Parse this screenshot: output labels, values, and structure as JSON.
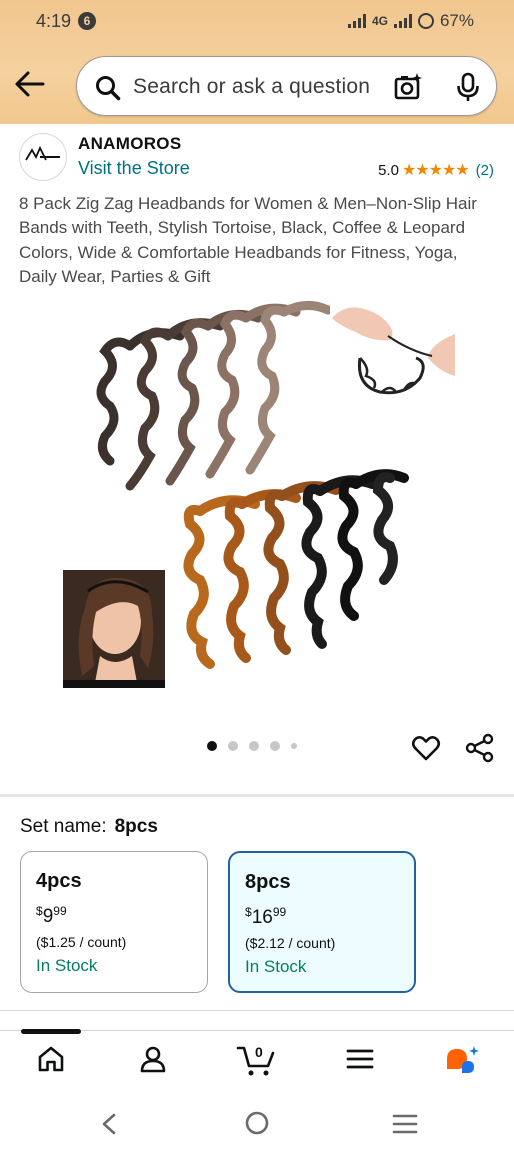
{
  "status_bar": {
    "time": "4:19",
    "notification_count": "6",
    "network": "4G",
    "battery": "67%"
  },
  "search": {
    "placeholder": "Search or ask a question"
  },
  "brand": {
    "name": "ANAMOROS",
    "visit_link": "Visit the Store",
    "rating": "5.0",
    "stars": "★★★★★",
    "review_count": "(2)"
  },
  "product": {
    "title": "8 Pack Zig Zag Headbands for Women & Men–Non-Slip Hair Bands with Teeth, Stylish Tortoise, Black, Coffee & Leopard Colors, Wide & Comfortable Headbands for Fitness, Yoga, Daily Wear, Parties & Gift",
    "image_count": 5,
    "current_image": 1
  },
  "set_name": {
    "label": "Set name:",
    "value": "8pcs"
  },
  "options": [
    {
      "label": "4pcs",
      "currency": "$",
      "whole": "9",
      "fraction": "99",
      "unit_price": "($1.25 / count)",
      "stock": "In Stock",
      "selected": false
    },
    {
      "label": "8pcs",
      "currency": "$",
      "whole": "16",
      "fraction": "99",
      "unit_price": "($2.12 / count)",
      "stock": "In Stock",
      "selected": true
    }
  ],
  "tabbar": {
    "cart_count": "0"
  },
  "colors": {
    "link": "#007185",
    "star": "#f08804",
    "in_stock": "#067d62",
    "selected_border": "#2162a1",
    "header_bg": "#f4d19e"
  }
}
